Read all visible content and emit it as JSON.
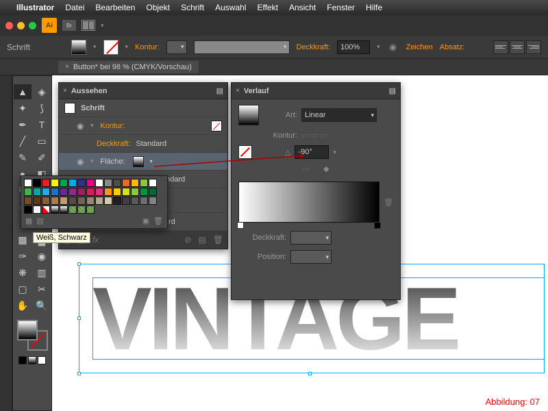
{
  "app_name": "Illustrator",
  "menu": [
    "Datei",
    "Bearbeiten",
    "Objekt",
    "Schrift",
    "Auswahl",
    "Effekt",
    "Ansicht",
    "Fenster",
    "Hilfe"
  ],
  "ai_badge": "Ai",
  "br_badge": "Br",
  "controlbar": {
    "context": "Schrift",
    "kontur_label": "Kontur:",
    "deckkraft_label": "Deckkraft:",
    "deckkraft_value": "100%",
    "zeichen": "Zeichen",
    "absatz": "Absatz:"
  },
  "doc_tab": "Button* bei 98 % (CMYK/Vorschau)",
  "canvas_text": "VINTAGE",
  "appearance": {
    "title": "Aussehen",
    "row_schrift": "Schrift",
    "row_kontur": "Kontur:",
    "row_deckkraft": "Deckkraft:",
    "row_deckkraft_val": "Standard",
    "row_flaeche": "Fläche:",
    "row_hidden1": "andard",
    "row_hidden2": "rd",
    "foot_fx": "fx"
  },
  "verlauf": {
    "title": "Verlauf",
    "art_label": "Art:",
    "art_value": "Linear",
    "kontur_label": "Kontur:",
    "angle_value": "-90°",
    "deckkraft_label": "Deckkraft:",
    "position_label": "Position:"
  },
  "tooltip": "Weiß, Schwarz",
  "caption": "Abbildung: 07",
  "swatch_colors": [
    "#ffffff",
    "#000000",
    "#ed1c24",
    "#fff200",
    "#00a651",
    "#00aeef",
    "#2e3192",
    "#ec008c",
    "#ffffff",
    "#898989",
    "#4d4d4d",
    "#f26522",
    "#fdb913",
    "#8dc63f",
    "#ffffff",
    "#39b54a",
    "#00a99d",
    "#27aae1",
    "#1c75bc",
    "#662d91",
    "#92278f",
    "#9e1f63",
    "#da1c5c",
    "#ee2a7b",
    "#f7941e",
    "#ffcb05",
    "#d7df23",
    "#8cc63f",
    "#009444",
    "#006838",
    "#754c29",
    "#603913",
    "#8b5e3c",
    "#a97c50",
    "#c49a6c",
    "#594a42",
    "#736357",
    "#998675",
    "#b5a990",
    "#d4c9a8",
    "#231f20",
    "#414042",
    "#58595b",
    "#6d6e71",
    "#808285",
    "#000000",
    "#ffffff",
    "#transparent",
    "#grad",
    "#grad2",
    "#pat1",
    "#pat2",
    "#pat3",
    "",
    "",
    "",
    "",
    "",
    "",
    ""
  ]
}
